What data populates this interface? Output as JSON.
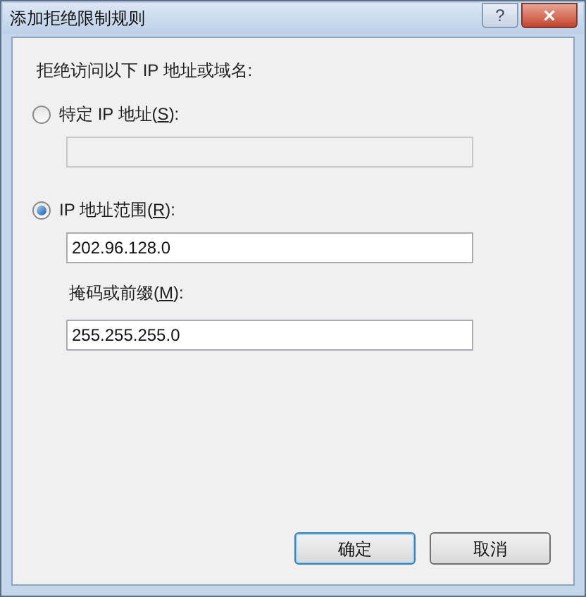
{
  "window": {
    "title": "添加拒绝限制规则",
    "title_buttons": [
      {
        "kind": "help",
        "label": "?"
      },
      {
        "kind": "close",
        "label": "×"
      }
    ]
  },
  "prompt": "拒绝访问以下 IP 地址或域名:",
  "options": [
    {
      "label_before": "特定 IP 地址(",
      "mnemonic": "S",
      "label_after": "):",
      "selected": false,
      "fields": [
        {
          "disabled": true
        }
      ]
    },
    {
      "label_before": "IP 地址范围(",
      "mnemonic": "R",
      "label_after": "):",
      "selected": true,
      "fields": [
        {
          "value": "202.96.128.0",
          "disabled": false
        },
        {
          "label_before": "掩码或前缀(",
          "mnemonic": "M",
          "label_after": "):",
          "value": "255.255.255.0",
          "disabled": false
        }
      ]
    }
  ],
  "buttons": [
    {
      "label": "确定",
      "default": true
    },
    {
      "label": "取消",
      "default": false
    }
  ]
}
